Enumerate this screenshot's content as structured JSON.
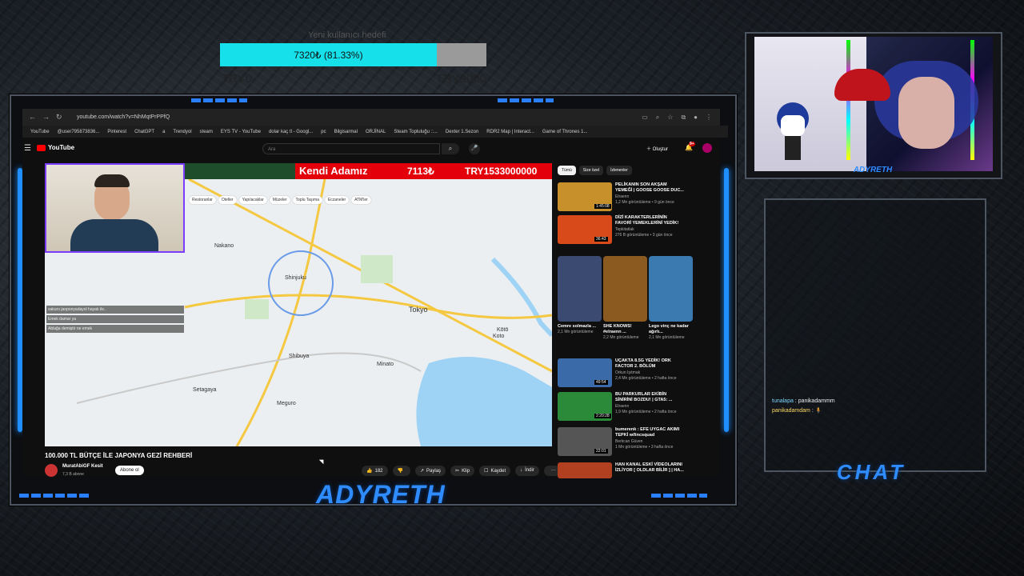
{
  "goal": {
    "title": "Yeni kullanıcı hedefi",
    "progress_label": "7320₺ (81.33%)",
    "progress_pct": 81.33,
    "min_label": "TRY0",
    "max_label": "TRY9000",
    "fill_color": "#16e0ea"
  },
  "browser": {
    "url": "youtube.com/watch?v=NhMqtPrPPfQ",
    "bookmarks": [
      "YouTube",
      "@user795873836...",
      "Pinterest",
      "ChatGPT",
      "a",
      "Trendyol",
      "steam",
      "EYS TV - YouTube",
      "dolar kaç tl - Googl...",
      "pc",
      "Bilgisarmal",
      "ORJİNAL",
      "Steam Topluluğu ::...",
      "Dexter 1.Sezon",
      "RDR2 Map | Interact...",
      "Game of Thrones 1..."
    ]
  },
  "youtube": {
    "logo": "YouTube",
    "search_placeholder": "Ara",
    "create_label": "Oluştur",
    "notif_count": "9+",
    "video_title": "100.000 TL BÜTÇE İLE JAPONYA GEZİ REHBERİ",
    "channel": "MuratAbiGF Kesit",
    "subs": "7,3 B abone",
    "subscribe": "Abone ol",
    "actions": [
      "182",
      "",
      "Paylaş",
      "Klip",
      "Kaydet",
      "İndir",
      "···"
    ],
    "chips": [
      "Tümü",
      "Size özel",
      "İzlenenler"
    ],
    "recs": [
      {
        "title": "PELİKANIN SON AKŞAM YEMEĞİ | GOOSE GOOSE DUC...",
        "channel": "Elraenn",
        "meta": "1,2 Mn görüntüleme • 9 gün önce",
        "dur": "1:45:08",
        "color": "#c8902a"
      },
      {
        "title": "DİZİ KARAKTERLERİNİN FAVORİ YEMEKLERİNİ YEDİK!",
        "channel": "Tepkitatlak",
        "meta": "276 B görüntüleme • 3 gün önce",
        "dur": "36:43",
        "color": "#d84a1a"
      },
      {
        "title": "UÇAKTA 8.5G YEDİK! ORK FACTOR 2. BÖLÜM",
        "channel": "Orkun Işıtmak",
        "meta": "2,4 Mn görüntüleme • 2 hafta önce",
        "dur": "49:54",
        "color": "#3a6aa8"
      },
      {
        "title": "BU PARKURLAR EKİBİN SİNİRİNİ BOZDU! | GTA5: ...",
        "channel": "Elraenn",
        "meta": "1,9 Mn görüntüleme • 2 hafta önce",
        "dur": "2:20:28",
        "color": "#2a8a3a"
      },
      {
        "title": "bumerenk : EFE UYGAC AKIMI TEPKİ w/lincsquad",
        "channel": "Berkcan Güven",
        "meta": "1 Mn görüntüleme • 3 hafta önce",
        "dur": "22:01",
        "color": "#555"
      },
      {
        "title": "HAN KANAL ESKİ VİDEOLARINI İZLİYOR [ OLDLAR BİLİR ] | HA...",
        "channel": "",
        "meta": "",
        "dur": "",
        "color": "#b04020"
      }
    ],
    "shorts": [
      {
        "title": "Cemre solmazla ...",
        "views": "2,1 Mn görüntüleme",
        "color": "#3a4a70"
      },
      {
        "title": "SHE KNOWS! #elraenn ...",
        "views": "2,2 Mn görüntüleme",
        "color": "#8a5a20"
      },
      {
        "title": "Lego vinç ne kadar ağırlı...",
        "views": "2,1 Mn görüntüleme",
        "color": "#3a7ab0"
      }
    ]
  },
  "stream_overlay": {
    "title_name": "Kendi Adamız",
    "title_price": "7113₺",
    "title_total": "TRY1533000000",
    "map_chips": [
      "Restoranlar",
      "Oteller",
      "Yapılacaklar",
      "Müzeler",
      "Toplu Taşıma",
      "Eczaneler",
      "ATM'ler"
    ],
    "map_labels": [
      "Nakano",
      "Shinjuku",
      "Tokyo",
      "Shibuya",
      "Setagaya",
      "Meguro",
      "Minato",
      "Kōtō",
      "Koto"
    ],
    "chat_overlay": [
      "sakuro jaoponyadayol hayatı ile..",
      "Emek damar ya",
      "Ablağa demiştir ne emek"
    ]
  },
  "branding": {
    "streamer_name": "ADYRETH",
    "cam_label": "ADYRETH",
    "chat_label": "CHAT"
  },
  "chat": {
    "messages": [
      {
        "user": "tunalapa",
        "text": ": panikadammm"
      },
      {
        "user": "panikadamdam",
        "text": ": 🧍"
      }
    ]
  }
}
